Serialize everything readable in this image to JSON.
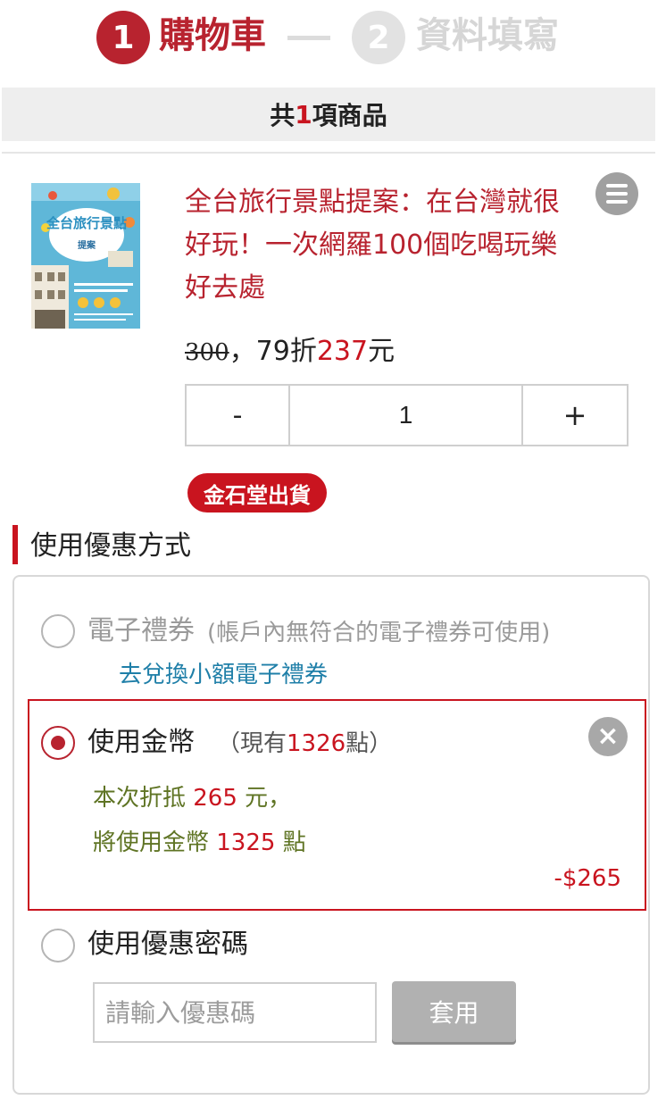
{
  "steps": [
    {
      "number": "1",
      "label": "購物車",
      "active": true
    },
    {
      "number": "2",
      "label": "資料填寫",
      "active": false
    }
  ],
  "cart_summary": {
    "prefix": "共",
    "count": "1",
    "suffix": "項商品"
  },
  "product": {
    "title": "全台旅行景點提案：在台灣就很好玩！一次網羅100個吃喝玩樂好去處",
    "cover_text": {
      "main": "全台旅行景點",
      "sub": "提案"
    },
    "original_price": "300",
    "price_sep": "，",
    "discount": "79折",
    "sale_price": "237",
    "currency": "元",
    "quantity": "1",
    "minus_label": "-",
    "plus_label": "+",
    "shipping_badge": "金石堂出貨"
  },
  "discount_section": {
    "title": "使用優惠方式",
    "ecoupon": {
      "label": "電子禮券",
      "note": "(帳戶內無符合的電子禮券可使用)",
      "link": "去兌換小額電子禮券",
      "checked": false
    },
    "gold_coin": {
      "label": "使用金幣",
      "balance_prefix": "（現有",
      "balance": "1326",
      "balance_suffix": "點）",
      "line1_prefix": "本次折抵 ",
      "line1_value": "265",
      "line1_suffix": " 元，",
      "line2_prefix": "將使用金幣 ",
      "line2_value": "1325",
      "line2_suffix": " 點",
      "amount": "-$265",
      "checked": true
    },
    "promo_code": {
      "label": "使用優惠密碼",
      "placeholder": "請輸入優惠碼",
      "apply_label": "套用",
      "checked": false
    }
  },
  "colors": {
    "brand_red": "#b8232f",
    "price_red": "#c9141f",
    "link_blue": "#1f7fa8",
    "note_olive": "#5f7424"
  }
}
